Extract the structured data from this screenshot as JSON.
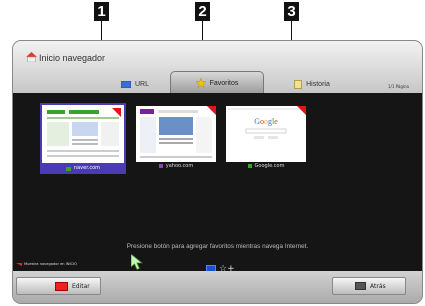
{
  "callouts": [
    "1",
    "2",
    "3"
  ],
  "header": {
    "title": "Inicio navegador",
    "page_counter": "1/1 Página"
  },
  "tabs": [
    {
      "label": "URL",
      "icon": "monitor-icon"
    },
    {
      "label": "Favoritos",
      "icon": "star-icon",
      "selected": true
    },
    {
      "label": "Historia",
      "icon": "history-icon"
    }
  ],
  "favorites": [
    {
      "label": "naver.com",
      "selected": true
    },
    {
      "label": "yahoo.com"
    },
    {
      "label": "Google.com"
    }
  ],
  "content": {
    "instruction": "Presione botón para agregar favoritos mientras navega Internet.",
    "home_hint": "Muestra navegador en INICIO"
  },
  "footer": {
    "edit_label": "Editar",
    "back_label": "Atrás"
  },
  "colors": {
    "selection": "#4b3ab6",
    "red_key": "#e22222",
    "blue_key": "#1f4fd1",
    "panel_background": "#151515"
  }
}
